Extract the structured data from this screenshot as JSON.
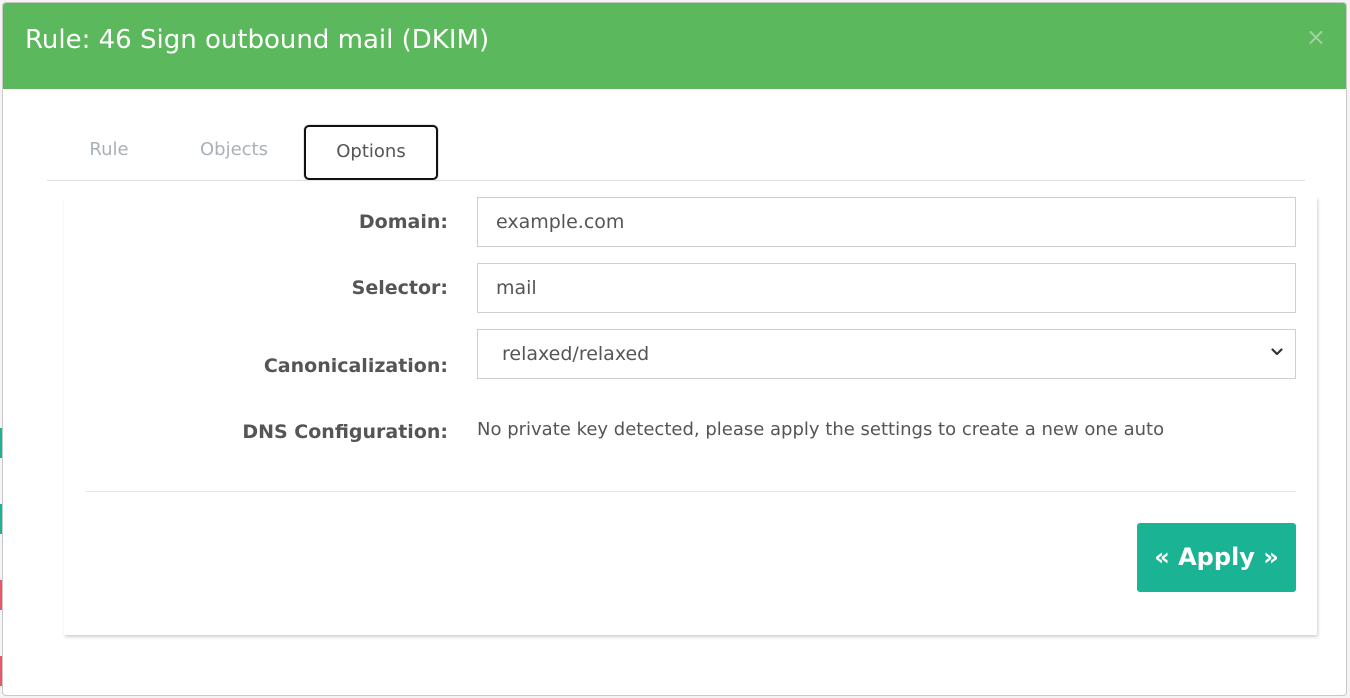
{
  "dialog": {
    "title": "Rule: 46 Sign outbound mail (DKIM)",
    "close_symbol": "×",
    "header_color": "#5cb85c"
  },
  "tabs": [
    {
      "label": "Rule",
      "active": false
    },
    {
      "label": "Objects",
      "active": false
    },
    {
      "label": "Options",
      "active": true
    }
  ],
  "form": {
    "domain": {
      "label": "Domain:",
      "value": "example.com"
    },
    "selector": {
      "label": "Selector:",
      "value": "mail"
    },
    "canonicalization": {
      "label": "Canonicalization:",
      "value": "relaxed/relaxed"
    },
    "dns": {
      "label": "DNS Configuration:",
      "text": "No private key detected, please apply the settings to create a new one auto"
    }
  },
  "apply_button": {
    "label": "« Apply »",
    "color": "#1ab394"
  },
  "icons": {
    "close": "close-icon",
    "dropdown": "chevron-down-icon"
  }
}
